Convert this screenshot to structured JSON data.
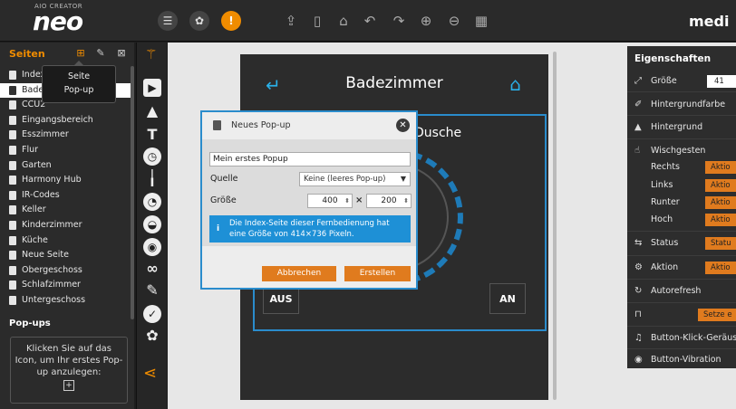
{
  "app": {
    "logo_small": "AIO CREATOR",
    "logo_big": "neo",
    "brand_right": "medi"
  },
  "toolbar": {
    "warn_symbol": "!"
  },
  "pages": {
    "title": "Seiten",
    "items": [
      "Index",
      "Badezimmer",
      "CCU2",
      "Eingangsbereich",
      "Esszimmer",
      "Flur",
      "Garten",
      "Harmony Hub",
      "IR-Codes",
      "Keller",
      "Kinderzimmer",
      "Küche",
      "Neue Seite",
      "Obergeschoss",
      "Schlafzimmer",
      "Untergeschoss"
    ],
    "tooltip_line1": "Seite",
    "tooltip_line2": "Pop-up"
  },
  "popups": {
    "title": "Pop-ups",
    "empty_text": "Klicken Sie auf das Icon, um Ihr erstes Pop-up anzulegen:"
  },
  "phone": {
    "title": "Badezimmer",
    "widget_label": "Dusche",
    "btn_off": "AUS",
    "btn_on": "AN"
  },
  "dialog": {
    "title": "Neues Pop-up",
    "name_value": "Mein erstes Popup",
    "source_label": "Quelle",
    "source_value": "Keine (leeres Pop-up)",
    "size_label": "Größe",
    "width_value": "400",
    "height_value": "200",
    "times": "×",
    "info": "Die Index-Seite dieser Fernbedienung hat eine Größe von 414×736 Pixeln.",
    "cancel_label": "Abbrechen",
    "create_label": "Erstellen"
  },
  "properties": {
    "title": "Eigenschaften",
    "size_label": "Größe",
    "size_value": "41",
    "bgcolor_label": "Hintergrundfarbe",
    "bg_label": "Hintergrund",
    "swipe_label": "Wischgesten",
    "right_label": "Rechts",
    "left_label": "Links",
    "down_label": "Runter",
    "up_label": "Hoch",
    "action_btn": "Aktio",
    "status_label": "Status",
    "status_btn": "Statu",
    "action_label": "Aktion",
    "autorefresh_label": "Autorefresh",
    "set_btn": "Setze e",
    "click_sound_label": "Button-Klick-Geräus",
    "vibration_label": "Button-Vibration"
  },
  "colors": {
    "accent": "#f08c00",
    "button_orange": "#e07b1e",
    "blue": "#2a8ccc",
    "panel_dark": "#2b2b2b"
  }
}
